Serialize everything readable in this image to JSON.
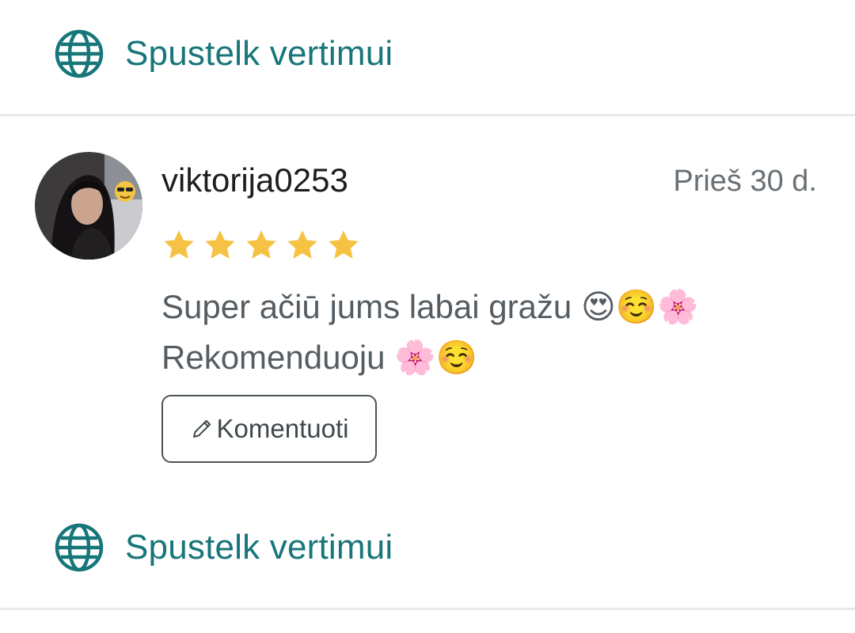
{
  "translate_top": {
    "label": "Spustelk vertimui",
    "icon": "globe-icon"
  },
  "review": {
    "username": "viktorija0253",
    "date": "Prieš 30 d.",
    "rating": 5,
    "rating_max": 5,
    "text_lines": [
      "Super ačiū jums labai gražu 😍☺️🌸",
      "Rekomenduoju 🌸☺️"
    ],
    "comment_button": {
      "label": "Komentuoti",
      "icon": "pencil-icon"
    }
  },
  "translate_bottom": {
    "label": "Spustelk vertimui",
    "icon": "globe-icon"
  },
  "colors": {
    "accent": "#17767a",
    "star": "#f6c244",
    "text": "#555d63",
    "username": "#1b1f22",
    "meta": "#6a7074",
    "divider": "#e6e8ea"
  }
}
